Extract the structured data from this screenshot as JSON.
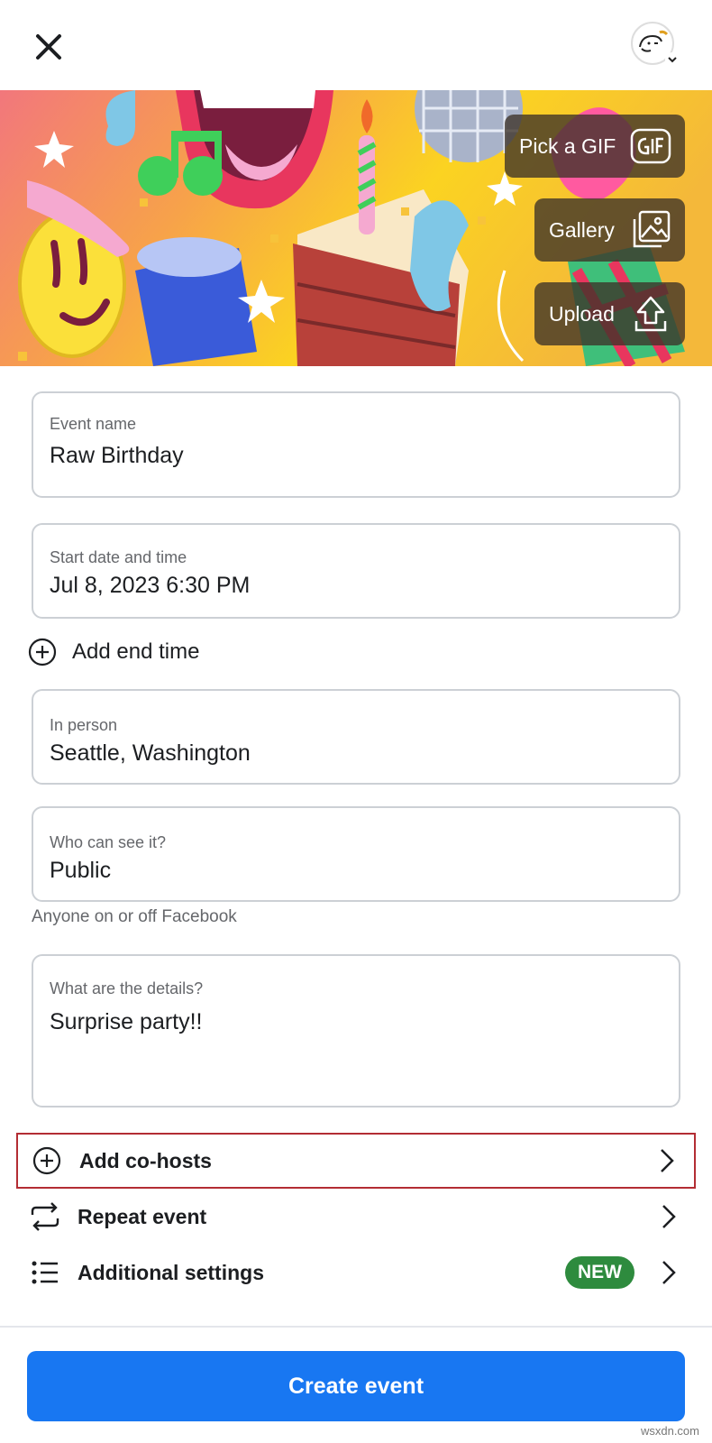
{
  "header": {
    "close_icon": "close-icon",
    "avatar_icon": "profile-avatar"
  },
  "cover": {
    "pick_gif_label": "Pick a GIF",
    "gallery_label": "Gallery",
    "upload_label": "Upload"
  },
  "form": {
    "event_name": {
      "label": "Event name",
      "value": "Raw Birthday"
    },
    "start": {
      "label": "Start date and time",
      "value": "Jul 8, 2023 6:30 PM"
    },
    "add_end_time": "Add end time",
    "location": {
      "label": "In person",
      "value": "Seattle, Washington"
    },
    "privacy": {
      "label": "Who can see it?",
      "value": "Public",
      "helper": "Anyone on or off Facebook"
    },
    "details": {
      "label": "What are the details?",
      "value": "Surprise party!!"
    }
  },
  "options": [
    {
      "label": "Add co-hosts",
      "icon": "plus-circle-icon",
      "highlighted": true
    },
    {
      "label": "Repeat event",
      "icon": "repeat-icon"
    },
    {
      "label": "Additional settings",
      "icon": "list-icon",
      "badge": "NEW"
    }
  ],
  "footer": {
    "create_label": "Create event"
  },
  "watermark": "wsxdn.com",
  "colors": {
    "primary": "#1877f2",
    "highlight_border": "#b32d34",
    "new_badge": "#2e8b3e"
  }
}
